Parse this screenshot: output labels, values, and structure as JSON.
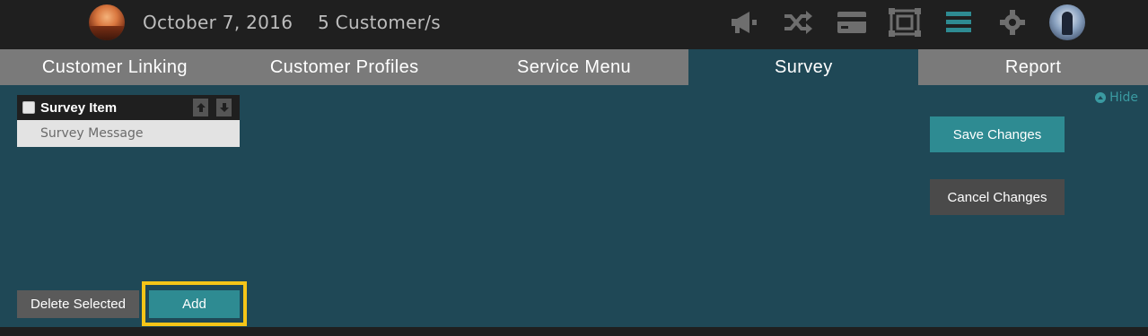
{
  "header": {
    "date": "October 7, 2016",
    "customers": "5 Customer/s",
    "icons": [
      "megaphone-icon",
      "shuffle-icon",
      "credit-card-icon",
      "resize-icon",
      "menu-icon",
      "gear-icon"
    ],
    "accent_color": "#2e8b92"
  },
  "tabs": [
    {
      "label": "Customer Linking",
      "active": false
    },
    {
      "label": "Customer Profiles",
      "active": false
    },
    {
      "label": "Service Menu",
      "active": false
    },
    {
      "label": "Survey",
      "active": true
    },
    {
      "label": "Report",
      "active": false
    }
  ],
  "panel": {
    "hide_label": "Hide",
    "list_title": "Survey Item",
    "rows": [
      "Survey Message"
    ],
    "save_label": "Save Changes",
    "cancel_label": "Cancel Changes",
    "delete_label": "Delete Selected",
    "add_label": "Add",
    "highlight_color": "#f5c518"
  }
}
